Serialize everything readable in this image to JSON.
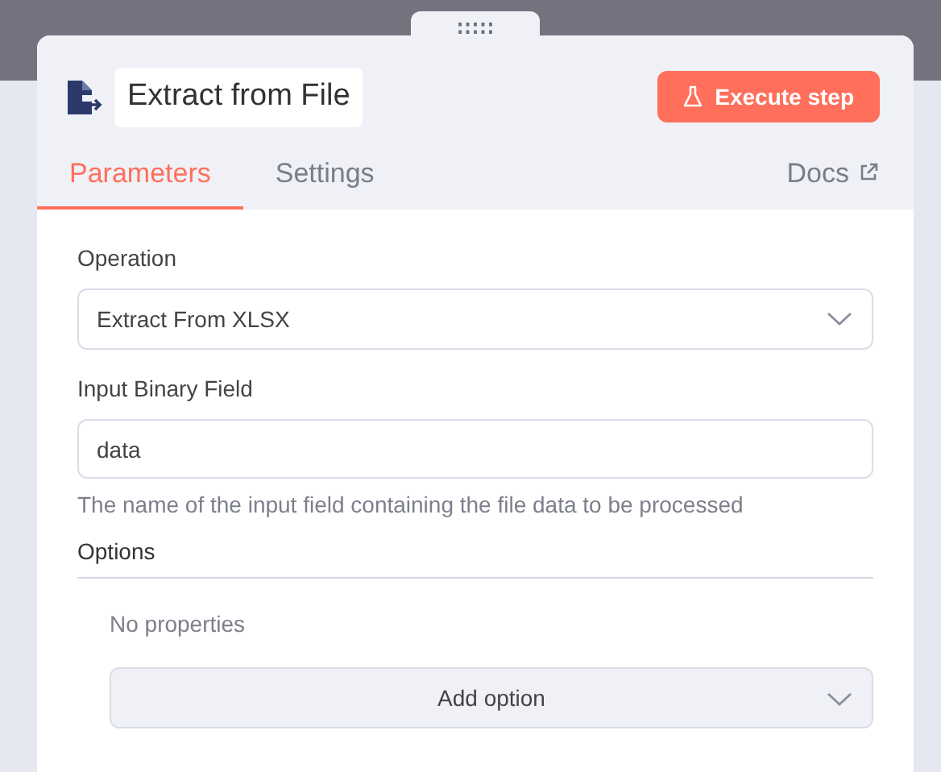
{
  "node": {
    "title": "Extract from File",
    "execute_button": "Execute step"
  },
  "tabs": [
    {
      "label": "Parameters",
      "selected": true
    },
    {
      "label": "Settings",
      "selected": false
    }
  ],
  "docs_link": "Docs",
  "fields": [
    {
      "kind": "select",
      "label": "Operation",
      "value": "Extract From XLSX"
    },
    {
      "kind": "input",
      "label": "Input Binary Field",
      "value": "data",
      "hint": "The name of the input field containing the file data to be processed"
    }
  ],
  "options": {
    "heading": "Options",
    "empty_text": "No properties",
    "add_button": "Add option"
  }
}
